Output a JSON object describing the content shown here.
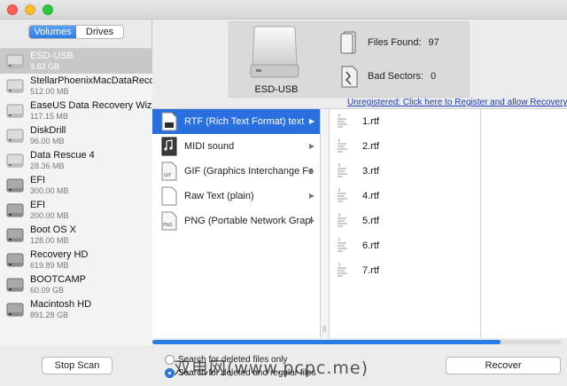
{
  "sidebar": {
    "tabs": [
      "Volumes",
      "Drives"
    ],
    "drives": [
      {
        "name": "ESD-USB",
        "size": "3.83 GB",
        "icon": "usb-drive-icon"
      },
      {
        "name": "StellarPhoenixMacDataRecov",
        "size": "512.00 MB",
        "icon": "usb-drive-icon"
      },
      {
        "name": "EaseUS Data Recovery Wizar",
        "size": "117.15 MB",
        "icon": "usb-drive-icon"
      },
      {
        "name": "DiskDrill",
        "size": "96.00 MB",
        "icon": "usb-drive-icon"
      },
      {
        "name": "Data Rescue 4",
        "size": "28.36 MB",
        "icon": "usb-drive-icon"
      },
      {
        "name": "EFI",
        "size": "300.00 MB",
        "icon": "hard-drive-icon"
      },
      {
        "name": "EFI",
        "size": "200.00 MB",
        "icon": "hard-drive-icon"
      },
      {
        "name": "Boot OS X",
        "size": "128.00 MB",
        "icon": "hard-drive-icon"
      },
      {
        "name": "Recovery HD",
        "size": "619.89 MB",
        "icon": "hard-drive-icon"
      },
      {
        "name": "BOOTCAMP",
        "size": "60.09 GB",
        "icon": "hard-drive-icon"
      },
      {
        "name": "Macintosh HD",
        "size": "891.28 GB",
        "icon": "hard-drive-icon"
      }
    ]
  },
  "status": {
    "drive_label": "ESD-USB",
    "files_found_label": "Files Found:",
    "files_found_value": "97",
    "bad_sectors_label": "Bad Sectors:",
    "bad_sectors_value": "0",
    "register_link": "Unregistered: Click here to Register and allow Recovery"
  },
  "file_types": [
    {
      "label": "RTF (Rich Text Format) text",
      "icon": "rtf-file-icon"
    },
    {
      "label": "MIDI sound",
      "icon": "midi-file-icon"
    },
    {
      "label": "GIF (Graphics Interchange For…",
      "icon": "gif-file-icon"
    },
    {
      "label": "Raw Text (plain)",
      "icon": "text-file-icon"
    },
    {
      "label": "PNG (Portable Network Graphics)",
      "icon": "png-file-icon"
    }
  ],
  "files": [
    "1.rtf",
    "2.rtf",
    "3.rtf",
    "4.rtf",
    "5.rtf",
    "6.rtf",
    "7.rtf"
  ],
  "progress": 0.85,
  "controls": {
    "stop_label": "Stop Scan",
    "recover_label": "Recover",
    "radio_deleted_only": "Search for deleted files only",
    "radio_deleted_and_regular": "Search for deleted and regular files"
  },
  "watermark": "双电网(www.pcpc.me)",
  "colors": {
    "accent": "#2a7de8",
    "selection": "#2a6fe0",
    "link": "#1c3fb8"
  }
}
